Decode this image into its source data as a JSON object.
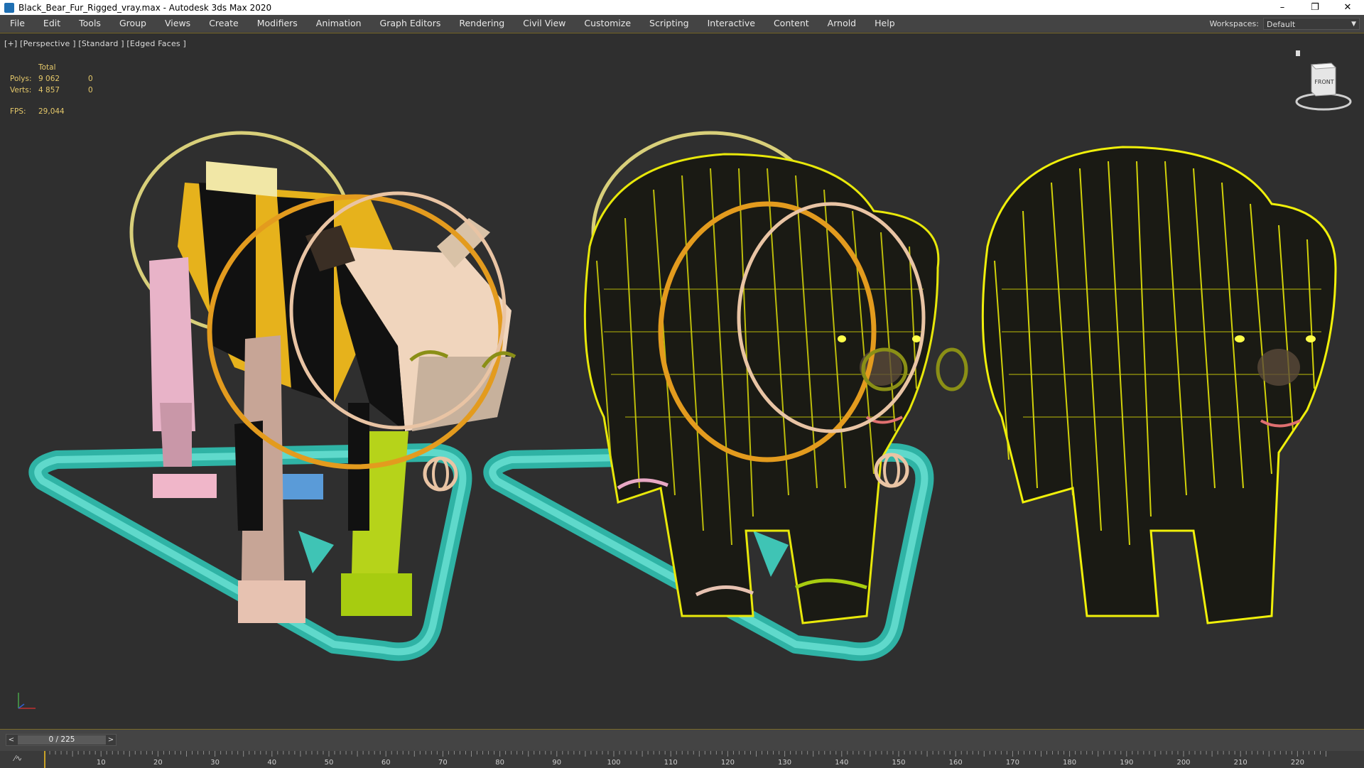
{
  "window": {
    "title": "Black_Bear_Fur_Rigged_vray.max - Autodesk 3ds Max 2020",
    "controls": [
      "–",
      "❐",
      "✕"
    ]
  },
  "menu": {
    "items": [
      "File",
      "Edit",
      "Tools",
      "Group",
      "Views",
      "Create",
      "Modifiers",
      "Animation",
      "Graph Editors",
      "Rendering",
      "Civil View",
      "Customize",
      "Scripting",
      "Interactive",
      "Content",
      "Arnold",
      "Help"
    ],
    "workspaces_label": "Workspaces:",
    "workspaces_value": "Default"
  },
  "viewport": {
    "label": "[+] [Perspective ] [Standard ] [Edged Faces ]",
    "stats": {
      "header": "Total",
      "polys_label": "Polys:",
      "polys_total": "9 062",
      "polys_sel": "0",
      "verts_label": "Verts:",
      "verts_total": "4 857",
      "verts_sel": "0",
      "fps_label": "FPS:",
      "fps_value": "29,044"
    },
    "viewcube_label": "FRONT"
  },
  "timeline": {
    "slider_text": "0 / 225",
    "prev": "<",
    "next": ">",
    "ticks": [
      "10",
      "20",
      "30",
      "40",
      "50",
      "60",
      "70",
      "80",
      "90",
      "100",
      "110",
      "120",
      "130",
      "140",
      "150",
      "160",
      "170",
      "180",
      "190",
      "200",
      "210",
      "220"
    ]
  },
  "colors": {
    "accent": "#c9a227",
    "fur": "#e6e600",
    "path": "#3fc4b5",
    "orange_ring": "#e39b1e",
    "pale_ring": "#d8cf7a",
    "peach_ring": "#e9c4a4"
  }
}
